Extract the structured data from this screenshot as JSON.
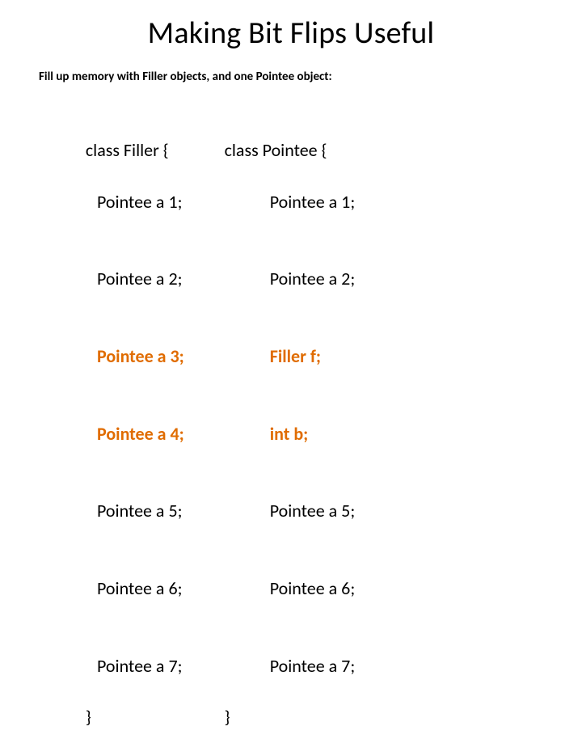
{
  "title": "Making Bit Flips Useful",
  "subtitle": "Fill up memory with Filler objects, and one Pointee object:",
  "left": {
    "head": "class Filler {",
    "l1": "Pointee a 1;",
    "l2": "Pointee a 2;",
    "l3": "Pointee a 3;",
    "l4": "Pointee a 4;",
    "l5": "Pointee a 5;",
    "l6": "Pointee a 6;",
    "l7": "Pointee a 7;",
    "tail": "}"
  },
  "right": {
    "head": "class Pointee {",
    "l1": "Pointee a 1;",
    "l2": "Pointee a 2;",
    "l3": "Filler f;",
    "l4": "int b;",
    "l5": "Pointee a 5;",
    "l6": "Pointee a 6;",
    "l7": "Pointee a 7;",
    "tail": "}"
  }
}
